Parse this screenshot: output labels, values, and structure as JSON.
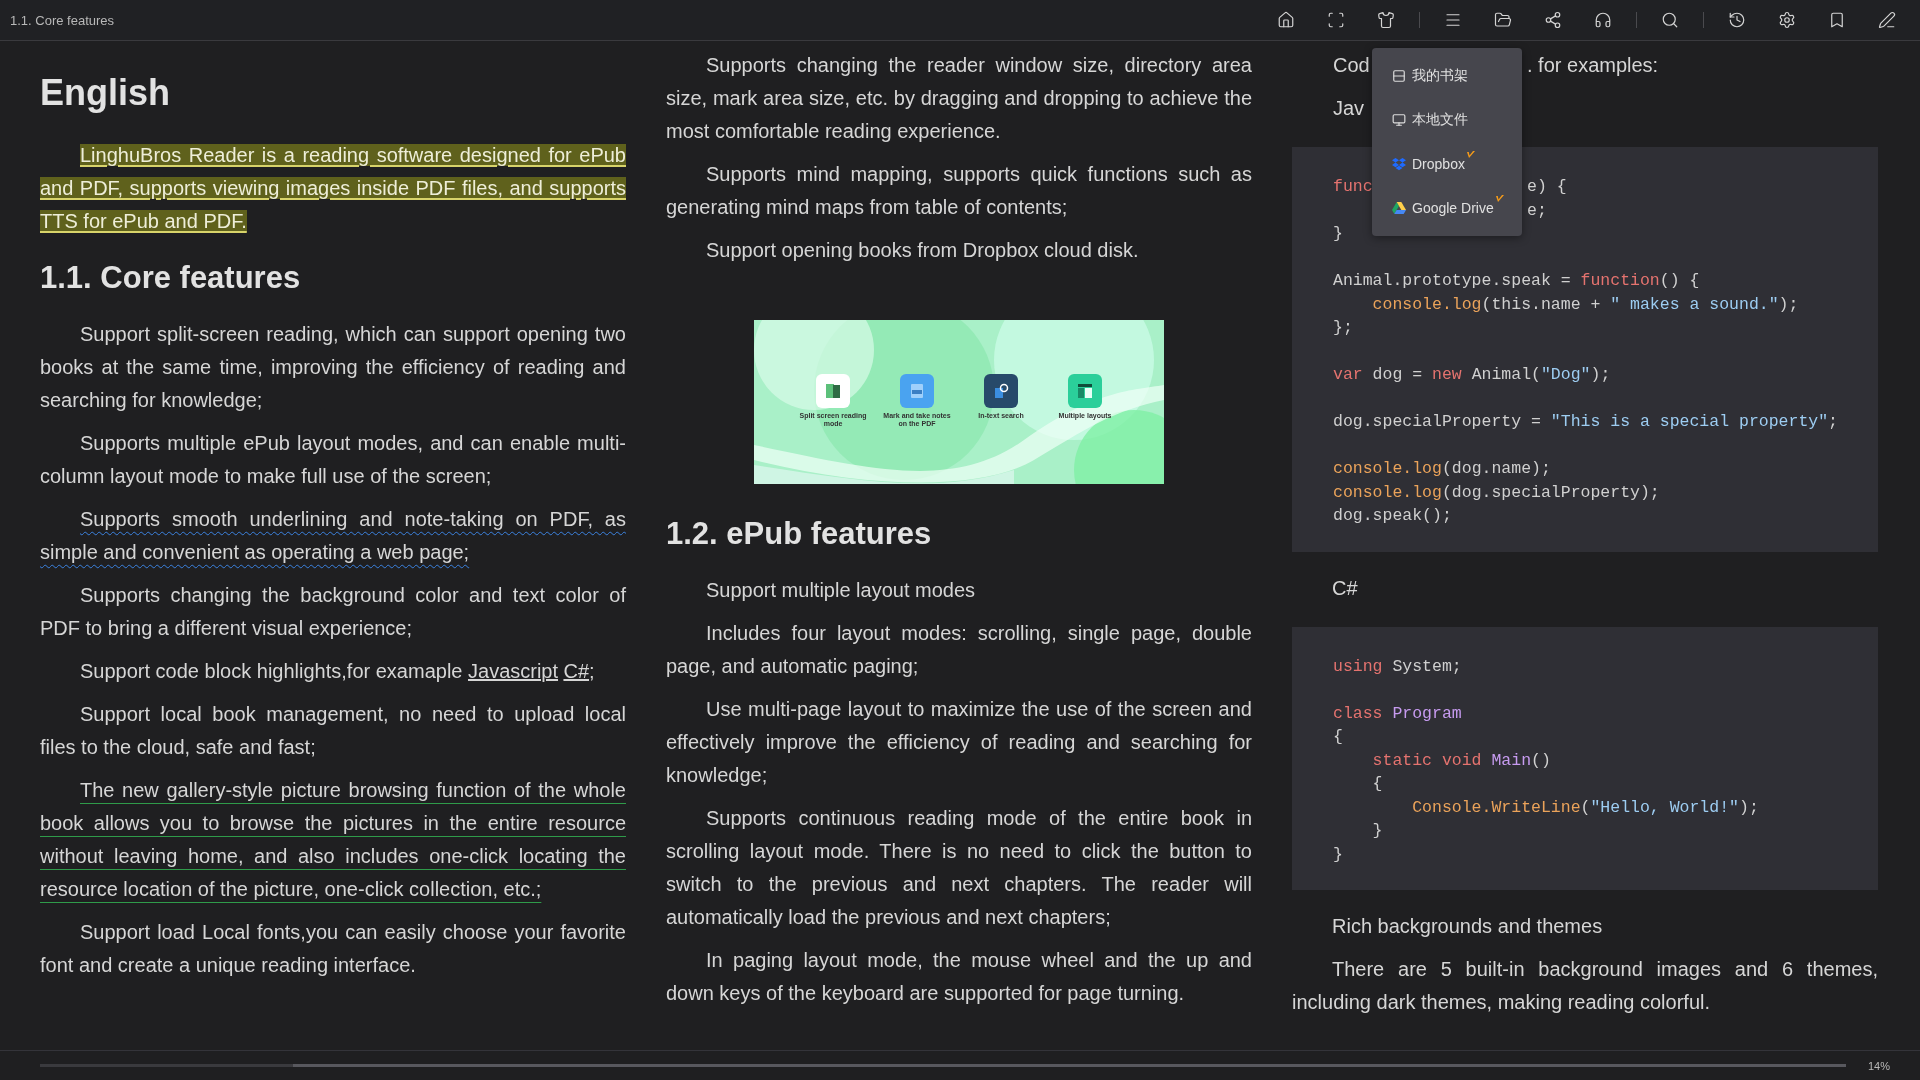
{
  "toolbar": {
    "title": "1.1. Core features",
    "groups": [
      [
        {
          "kind": "home"
        },
        {
          "kind": "fullscreen"
        },
        {
          "kind": "theme"
        }
      ],
      [
        {
          "kind": "menu"
        },
        {
          "kind": "folder"
        },
        {
          "kind": "mindmap"
        },
        {
          "kind": "listen"
        }
      ],
      [
        {
          "kind": "search"
        }
      ],
      [
        {
          "kind": "history"
        },
        {
          "kind": "settings"
        },
        {
          "kind": "bookmark"
        },
        {
          "kind": "edit"
        }
      ]
    ]
  },
  "menu": {
    "items": [
      {
        "kind": "shelf",
        "label": "我的书架",
        "vip": false
      },
      {
        "kind": "local",
        "label": "本地文件",
        "vip": false
      },
      {
        "kind": "dropbox",
        "label": "Dropbox",
        "vip": true
      },
      {
        "kind": "gdrive",
        "label": "Google Drive",
        "vip": true
      }
    ]
  },
  "columns": [
    {
      "blocks": [
        {
          "kind": "h1",
          "text": "English"
        },
        {
          "kind": "highlighted",
          "text": "LinghuBros Reader is a reading software designed for ePub and PDF, supports viewing images inside PDF files, and supports TTS for ePub and PDF."
        },
        {
          "kind": "h2",
          "text": "1.1. Core features"
        },
        {
          "kind": "p",
          "text": "Support split-screen reading, which can support opening two books at the same time, improving the efficiency of reading and searching for knowledge;"
        },
        {
          "kind": "p",
          "text": "Supports multiple ePub layout modes, and can enable multi-column layout mode to make full use of the screen;"
        },
        {
          "kind": "wavy",
          "text": "Supports smooth underlining and note-taking on PDF, as simple and convenient as operating a web page;"
        },
        {
          "kind": "p",
          "text": "Supports changing the background color and text color of PDF to bring a different visual experience;"
        },
        {
          "kind": "rich",
          "segments": [
            {
              "kind": "text",
              "text": "Support code block highlights,for examaple "
            },
            {
              "kind": "link",
              "text": "Javascript"
            },
            {
              "kind": "link",
              "text": "C#"
            },
            {
              "kind": "text",
              "text": ";"
            }
          ]
        },
        {
          "kind": "p",
          "text": "Support local book management, no need to upload local files to the cloud, safe and fast;"
        },
        {
          "kind": "underlined",
          "text": "The new gallery-style picture browsing function of the whole book allows you to browse the pictures in the entire resource without leaving home, and also includes one-click locating the resource location of the picture, one-click collection, etc.;"
        },
        {
          "kind": "p",
          "text": "Support load Local fonts,you can easily choose your favorite font and create a unique reading interface."
        }
      ]
    },
    {
      "blocks": [
        {
          "kind": "p",
          "text": "Supports changing the reader window size, directory area size, mark area size, etc. by dragging and dropping to achieve the most comfortable reading experience."
        },
        {
          "kind": "p",
          "text": "Supports mind mapping, supports quick functions such as generating mind maps from table of contents;"
        },
        {
          "kind": "p",
          "text": "Support opening books from Dropbox cloud disk."
        },
        {
          "kind": "figure",
          "tiles": [
            {
              "label": "Split screen reading mode",
              "color": "#ffffff"
            },
            {
              "label": "Mark and take notes on the PDF",
              "color": "#4aa3f0"
            },
            {
              "label": "In-text search",
              "color": "#274a6a"
            },
            {
              "label": "Multiple layouts",
              "color": "#2bcf9a"
            }
          ]
        },
        {
          "kind": "h2",
          "text": "1.2. ePub features"
        },
        {
          "kind": "p",
          "text": "Support multiple layout modes"
        },
        {
          "kind": "p",
          "text": "Includes four layout modes: scrolling, single page, double page, and automatic paging;"
        },
        {
          "kind": "p",
          "text": "Use multi-page layout to maximize the use of the screen and effectively improve the efficiency of reading and searching for knowledge;"
        },
        {
          "kind": "p",
          "text": "Supports continuous reading mode of the entire book in scrolling layout mode. There is no need to click the button to switch to the previous and next chapters. The reader will automatically load the previous and next chapters;"
        },
        {
          "kind": "p",
          "text": "In paging layout mode, the mouse wheel and the up and down keys of the keyboard are supported for page turning."
        }
      ]
    },
    {
      "blocks": [
        {
          "kind": "split",
          "before": "Cod",
          "after": ". for examples:"
        },
        {
          "kind": "short",
          "text": "Jav"
        },
        {
          "kind": "code",
          "lines": [
            {
              "kind": "covered",
              "before": [
                {
                  "kind": "keyword",
                  "text": "func"
                }
              ],
              "after": [
                {
                  "kind": "plain",
                  "text": "e) {"
                }
              ]
            },
            {
              "kind": "covered",
              "after": [
                {
                  "kind": "plain",
                  "text": "e;"
                }
              ]
            },
            {
              "kind": "code",
              "tokens": [
                {
                  "kind": "plain",
                  "text": "}"
                }
              ]
            },
            {
              "kind": "blank"
            },
            {
              "kind": "code",
              "tokens": [
                {
                  "kind": "plain",
                  "text": "Animal.prototype.speak = "
                },
                {
                  "kind": "keyword",
                  "text": "function"
                },
                {
                  "kind": "plain",
                  "text": "() {"
                }
              ]
            },
            {
              "kind": "code",
              "tokens": [
                {
                  "kind": "call",
                  "text": "    console.log"
                },
                {
                  "kind": "plain",
                  "text": "(this.name + "
                },
                {
                  "kind": "string",
                  "text": "\" makes a sound.\""
                },
                {
                  "kind": "plain",
                  "text": ");"
                }
              ]
            },
            {
              "kind": "code",
              "tokens": [
                {
                  "kind": "plain",
                  "text": "};"
                }
              ]
            },
            {
              "kind": "blank"
            },
            {
              "kind": "code",
              "tokens": [
                {
                  "kind": "keyword",
                  "text": "var"
                },
                {
                  "kind": "plain",
                  "text": " dog = "
                },
                {
                  "kind": "keyword",
                  "text": "new"
                },
                {
                  "kind": "plain",
                  "text": " Animal("
                },
                {
                  "kind": "string",
                  "text": "\"Dog\""
                },
                {
                  "kind": "plain",
                  "text": ");"
                }
              ]
            },
            {
              "kind": "blank"
            },
            {
              "kind": "code",
              "tokens": [
                {
                  "kind": "plain",
                  "text": "dog.specialProperty = "
                },
                {
                  "kind": "string",
                  "text": "\"This is a special property\""
                },
                {
                  "kind": "plain",
                  "text": ";"
                }
              ]
            },
            {
              "kind": "blank"
            },
            {
              "kind": "code",
              "tokens": [
                {
                  "kind": "call",
                  "text": "console.log"
                },
                {
                  "kind": "plain",
                  "text": "(dog.name);"
                }
              ]
            },
            {
              "kind": "code",
              "tokens": [
                {
                  "kind": "call",
                  "text": "console.log"
                },
                {
                  "kind": "plain",
                  "text": "(dog.specialProperty);"
                }
              ]
            },
            {
              "kind": "code",
              "tokens": [
                {
                  "kind": "plain",
                  "text": "dog.speak();"
                }
              ]
            }
          ]
        },
        {
          "kind": "p",
          "text": "C#"
        },
        {
          "kind": "code",
          "lines": [
            {
              "kind": "code",
              "tokens": [
                {
                  "kind": "keyword",
                  "text": "using"
                },
                {
                  "kind": "plain",
                  "text": " System;"
                }
              ]
            },
            {
              "kind": "blank"
            },
            {
              "kind": "code",
              "tokens": [
                {
                  "kind": "keyword",
                  "text": "class"
                },
                {
                  "kind": "type",
                  "text": " Program"
                }
              ]
            },
            {
              "kind": "code",
              "tokens": [
                {
                  "kind": "plain",
                  "text": "{"
                }
              ]
            },
            {
              "kind": "code",
              "tokens": [
                {
                  "kind": "keyword",
                  "text": "    static void"
                },
                {
                  "kind": "type",
                  "text": " Main"
                },
                {
                  "kind": "plain",
                  "text": "()"
                }
              ]
            },
            {
              "kind": "code",
              "tokens": [
                {
                  "kind": "plain",
                  "text": "    {"
                }
              ]
            },
            {
              "kind": "code",
              "tokens": [
                {
                  "kind": "call",
                  "text": "        Console.WriteLine"
                },
                {
                  "kind": "plain",
                  "text": "("
                },
                {
                  "kind": "string",
                  "text": "\"Hello, World!\""
                },
                {
                  "kind": "plain",
                  "text": ");"
                }
              ]
            },
            {
              "kind": "code",
              "tokens": [
                {
                  "kind": "plain",
                  "text": "    }"
                }
              ]
            },
            {
              "kind": "code",
              "tokens": [
                {
                  "kind": "plain",
                  "text": "}"
                }
              ]
            }
          ]
        },
        {
          "kind": "p",
          "text": "Rich backgrounds and themes"
        },
        {
          "kind": "p",
          "text": "There are 5 built-in background images and 6 themes, including dark themes, making reading colorful."
        }
      ]
    }
  ],
  "progress": {
    "level": 0.14,
    "reading": "14%"
  }
}
